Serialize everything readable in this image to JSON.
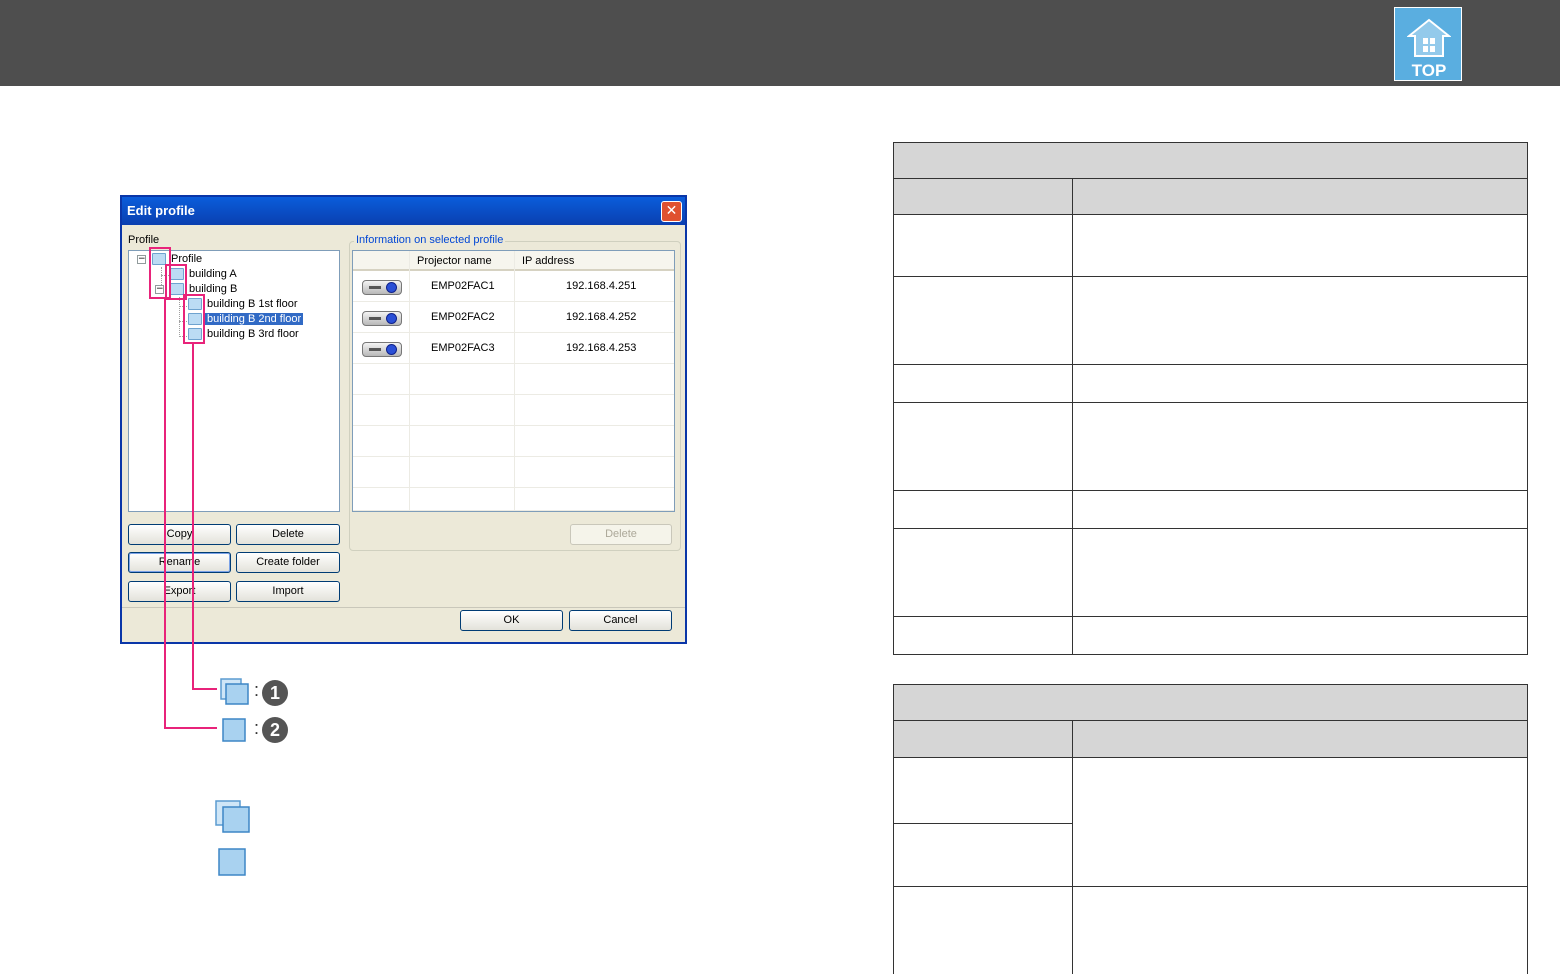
{
  "header": {
    "top_button_label": "TOP"
  },
  "dialog": {
    "title": "Edit profile",
    "close_glyph": "✕",
    "profile_label": "Profile",
    "info_group_title": "Information on selected profile",
    "tree": [
      {
        "label": "Profile",
        "level": 0,
        "expander": "−"
      },
      {
        "label": "building A",
        "level": 1
      },
      {
        "label": "building B",
        "level": 1,
        "expander": "−"
      },
      {
        "label": "building B 1st floor",
        "level": 2
      },
      {
        "label": "building B 2nd floor",
        "level": 2,
        "selected": true
      },
      {
        "label": "building B 3rd floor",
        "level": 2
      }
    ],
    "columns": [
      "Projector name",
      "IP address"
    ],
    "rows": [
      {
        "name": "EMP02FAC1",
        "ip": "192.168.4.251"
      },
      {
        "name": "EMP02FAC2",
        "ip": "192.168.4.252"
      },
      {
        "name": "EMP02FAC3",
        "ip": "192.168.4.253"
      }
    ],
    "buttons": {
      "copy": "Copy",
      "delete": "Delete",
      "rename": "Rename",
      "create_folder": "Create folder",
      "export": "Export",
      "import": "Import",
      "list_delete": "Delete",
      "ok": "OK",
      "cancel": "Cancel"
    }
  },
  "legend": [
    {
      "separator": ":",
      "number": "1"
    },
    {
      "separator": ":",
      "number": "2"
    }
  ],
  "colors": {
    "header_bg": "#4e4e4e",
    "callout": "#e8237a",
    "table_header": "#d6d6d6"
  }
}
